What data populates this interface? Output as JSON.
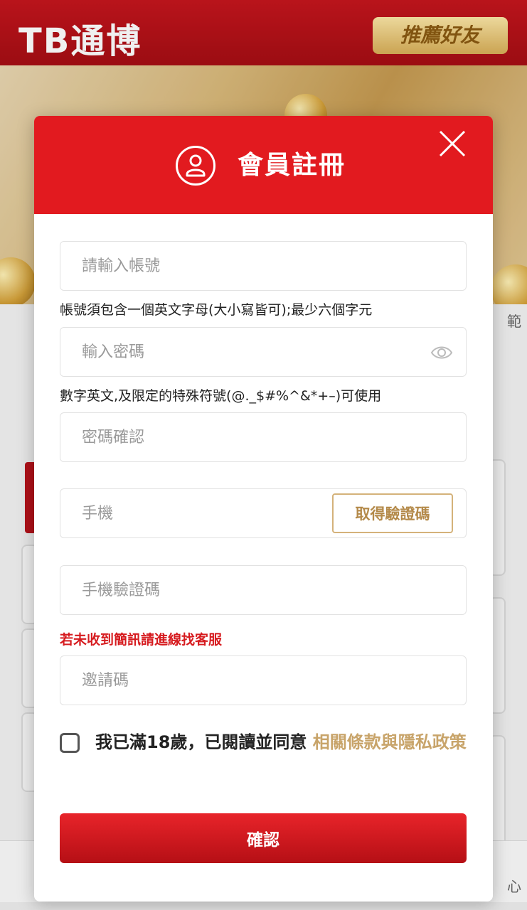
{
  "app": {
    "logo_text": "TB通博",
    "refer_button": "推薦好友"
  },
  "modal": {
    "title": "會員註冊",
    "account_placeholder": "請輸入帳號",
    "account_hint": "帳號須包含一個英文字母(大小寫皆可);最少六個字元",
    "password_placeholder": "輸入密碼",
    "password_hint": "數字英文,及限定的特殊符號(@._$#%^&*+–)可使用",
    "confirm_password_placeholder": "密碼確認",
    "phone_placeholder": "手機",
    "get_code_button": "取得驗證碼",
    "sms_code_placeholder": "手機驗證碼",
    "sms_hint": "若未收到簡訊請進線找客服",
    "invite_code_placeholder": "邀請碼",
    "agree_text": "我已滿18歲，已閱讀並同意 ",
    "agree_link": "相關條款與隱私政策",
    "confirm_button": "確認"
  },
  "background": {
    "edge_text_1": "範",
    "edge_text_2": "心"
  },
  "colors": {
    "brand_red": "#e21a1f",
    "accent_gold": "#c8a46a",
    "hint_red": "#d61b1f"
  }
}
